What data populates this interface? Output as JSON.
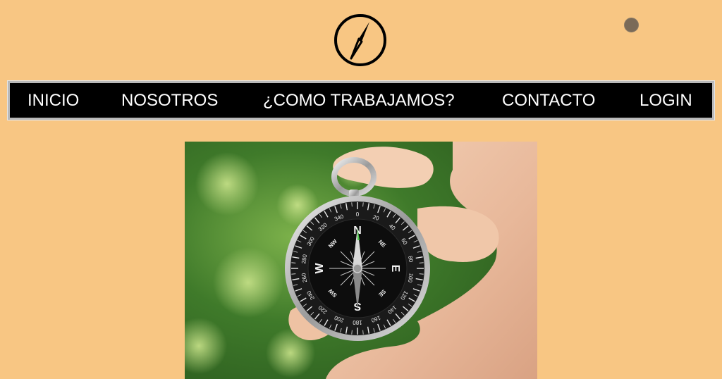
{
  "header": {
    "logo_icon": "compass-logo-icon",
    "user_indicator_icon": "circle-dot-icon"
  },
  "nav": {
    "items": [
      {
        "label": "INICIO"
      },
      {
        "label": "NOSOTROS"
      },
      {
        "label": "¿COMO TRABAJAMOS?"
      },
      {
        "label": "CONTACTO"
      },
      {
        "label": "LOGIN"
      }
    ]
  },
  "hero": {
    "image": "hand-holding-compass-photo",
    "compass": {
      "cardinals": [
        "N",
        "E",
        "S",
        "W"
      ],
      "intercardinals": [
        "NE",
        "SE",
        "SW",
        "NW"
      ],
      "degree_labels": [
        "0",
        "20",
        "40",
        "60",
        "80",
        "100",
        "120",
        "140",
        "160",
        "180",
        "200",
        "220",
        "240",
        "260",
        "280",
        "300",
        "320",
        "340"
      ]
    }
  },
  "colors": {
    "background": "#f8c683",
    "navbar": "#000000",
    "nav_text": "#ffffff",
    "nav_border": "#b9b9b9"
  }
}
